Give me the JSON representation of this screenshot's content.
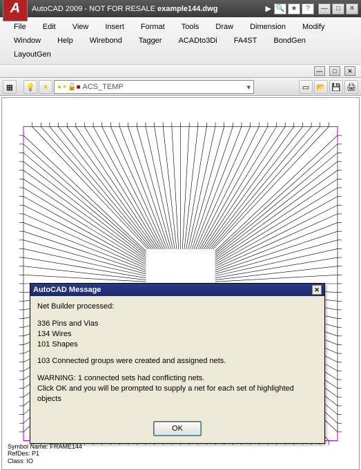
{
  "titlebar": {
    "logo_text": "A",
    "app": "AutoCAD 2009 - NOT FOR RESALE",
    "doc": "example144.dwg",
    "arrow": "▶"
  },
  "menu": {
    "items": [
      "File",
      "Edit",
      "View",
      "Insert",
      "Format",
      "Tools",
      "Draw",
      "Dimension",
      "Modify",
      "Window",
      "Help",
      "Wirebond",
      "Tagger",
      "ACADto3Di",
      "FA4ST",
      "BondGen",
      "LayoutGen"
    ]
  },
  "layer": {
    "name": "ACS_TEMP"
  },
  "meta": {
    "l1": "Symbol Name: FRAME144",
    "l2": "RefDes: P1",
    "l3": "Class: IO"
  },
  "dialog": {
    "title": "AutoCAD Message",
    "p1": "Net Builder processed:",
    "p2a": "336 Pins and Vias",
    "p2b": "134 Wires",
    "p2c": "101 Shapes",
    "p3": "103 Connected groups were created and assigned nets.",
    "p4a": "WARNING: 1 connected sets had conflicting nets.",
    "p4b": "Click OK and you will be prompted to supply a net for each set of highlighted objects",
    "ok": "OK",
    "close": "✕"
  },
  "win": {
    "min": "—",
    "max": "□",
    "close": "✕"
  },
  "icons": {
    "search": "🔍",
    "star": "★",
    "help": "?",
    "open": "📂",
    "save": "💾",
    "print": "🖨",
    "new": "▭",
    "bulb": "💡",
    "sun": "☀",
    "lock": "🔒",
    "square": "■"
  }
}
